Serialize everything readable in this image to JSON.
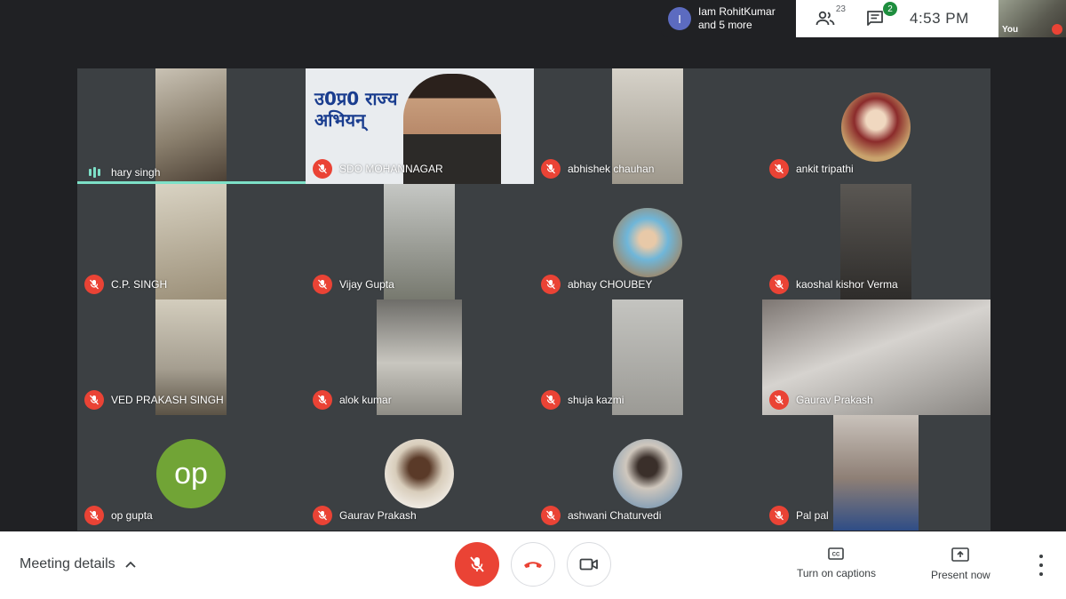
{
  "top": {
    "join_initial": "I",
    "join_text_line1": "Iam RohitKumar",
    "join_text_line2": "and 5 more",
    "people_count": "23",
    "chat_badge": "2",
    "time": "4:53 PM",
    "self_label": "You"
  },
  "tiles": [
    {
      "name": "hary singh",
      "speaking": true
    },
    {
      "name": "SDO MOHANNAGAR",
      "speaking": false,
      "banner_text": "उ0प्र0 राज्य\nअभियन्"
    },
    {
      "name": "abhishek chauhan",
      "speaking": false
    },
    {
      "name": "ankit tripathi",
      "speaking": false
    },
    {
      "name": "C.P. SINGH",
      "speaking": false
    },
    {
      "name": "Vijay Gupta",
      "speaking": false
    },
    {
      "name": "abhay CHOUBEY",
      "speaking": false
    },
    {
      "name": "kaoshal kishor Verma",
      "speaking": false
    },
    {
      "name": "VED PRAKASH SINGH",
      "speaking": false
    },
    {
      "name": "alok kumar",
      "speaking": false
    },
    {
      "name": "shuja kazmi",
      "speaking": false
    },
    {
      "name": "Gaurav Prakash",
      "speaking": false
    },
    {
      "name": "op gupta",
      "speaking": false,
      "avatar_initials": "op"
    },
    {
      "name": "Gaurav Prakash",
      "speaking": false
    },
    {
      "name": "ashwani Chaturvedi",
      "speaking": false
    },
    {
      "name": "Pal pal",
      "speaking": false
    }
  ],
  "bottom": {
    "meeting_details": "Meeting details",
    "captions_label": "Turn on captions",
    "present_label": "Present now"
  },
  "colors": {
    "background": "#202124",
    "tile": "#3c4043",
    "mic_off_red": "#ea4335",
    "speaking_accent": "#7de0c7",
    "avatar_green": "#71a436",
    "join_avatar": "#5c6bc0"
  }
}
